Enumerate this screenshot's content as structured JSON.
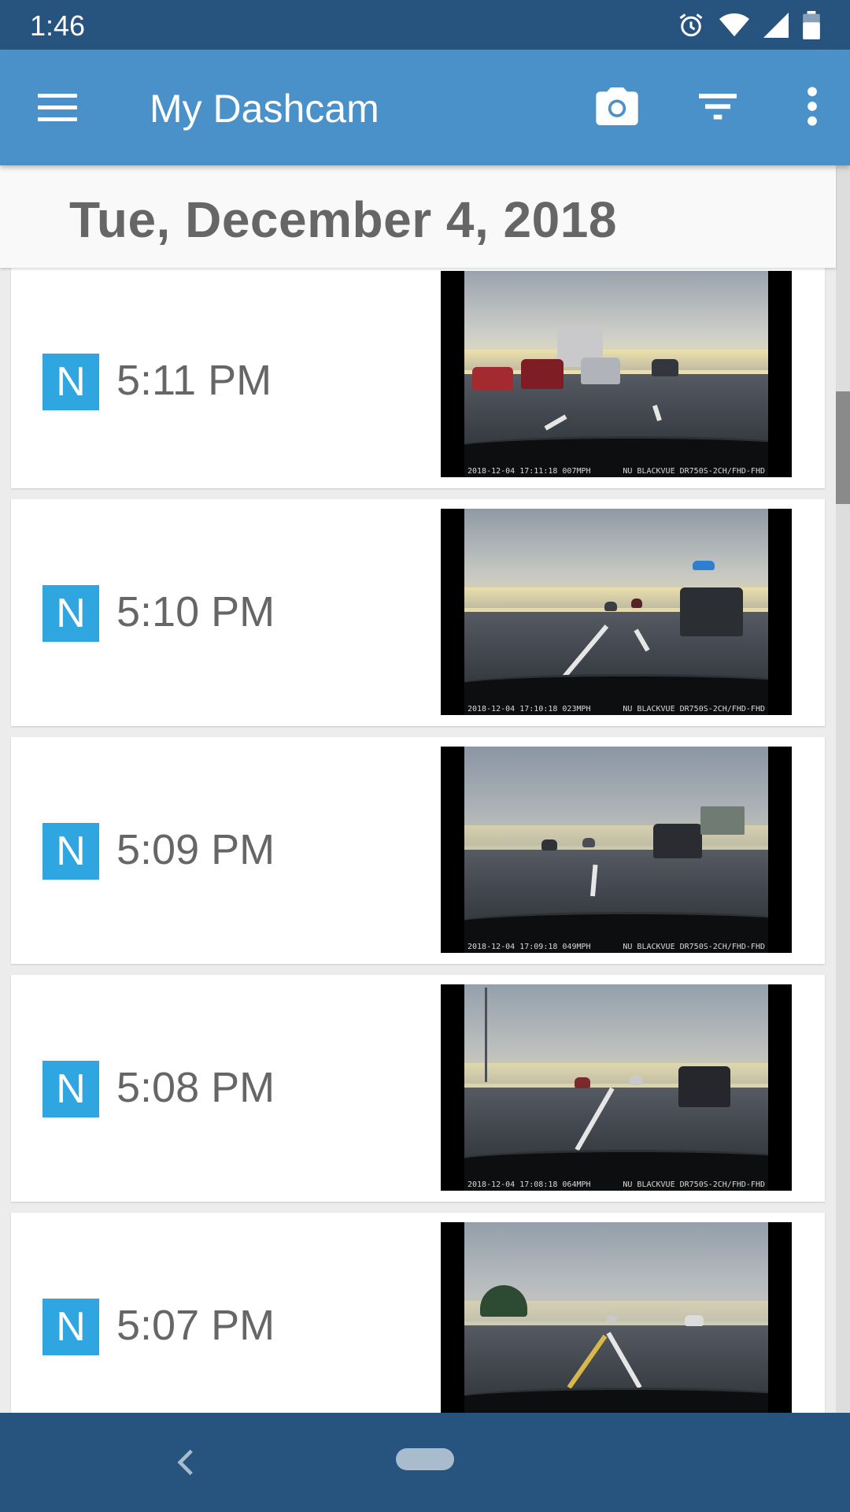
{
  "status": {
    "time": "1:46"
  },
  "app_bar": {
    "title": "My Dashcam",
    "icons": [
      "menu-icon",
      "camera-icon",
      "filter-icon",
      "more-vert-icon"
    ]
  },
  "date_header": "Tue, December 4, 2018",
  "recordings": [
    {
      "badge": "N",
      "time": "5:11 PM",
      "overlay_left": "2018-12-04 17:11:18 007MPH",
      "overlay_right": "NU BLACKVUE DR750S-2CH/FHD-FHD"
    },
    {
      "badge": "N",
      "time": "5:10 PM",
      "overlay_left": "2018-12-04 17:10:18 023MPH",
      "overlay_right": "NU BLACKVUE DR750S-2CH/FHD-FHD"
    },
    {
      "badge": "N",
      "time": "5:09 PM",
      "overlay_left": "2018-12-04 17:09:18 049MPH",
      "overlay_right": "NU BLACKVUE DR750S-2CH/FHD-FHD"
    },
    {
      "badge": "N",
      "time": "5:08 PM",
      "overlay_left": "2018-12-04 17:08:18 064MPH",
      "overlay_right": "NU BLACKVUE DR750S-2CH/FHD-FHD"
    },
    {
      "badge": "N",
      "time": "5:07 PM",
      "overlay_left": "",
      "overlay_right": ""
    }
  ],
  "colors": {
    "status_bar": "#27547f",
    "app_bar": "#4a90c9",
    "badge": "#2fa6e0",
    "nav_bar": "#27547f"
  }
}
